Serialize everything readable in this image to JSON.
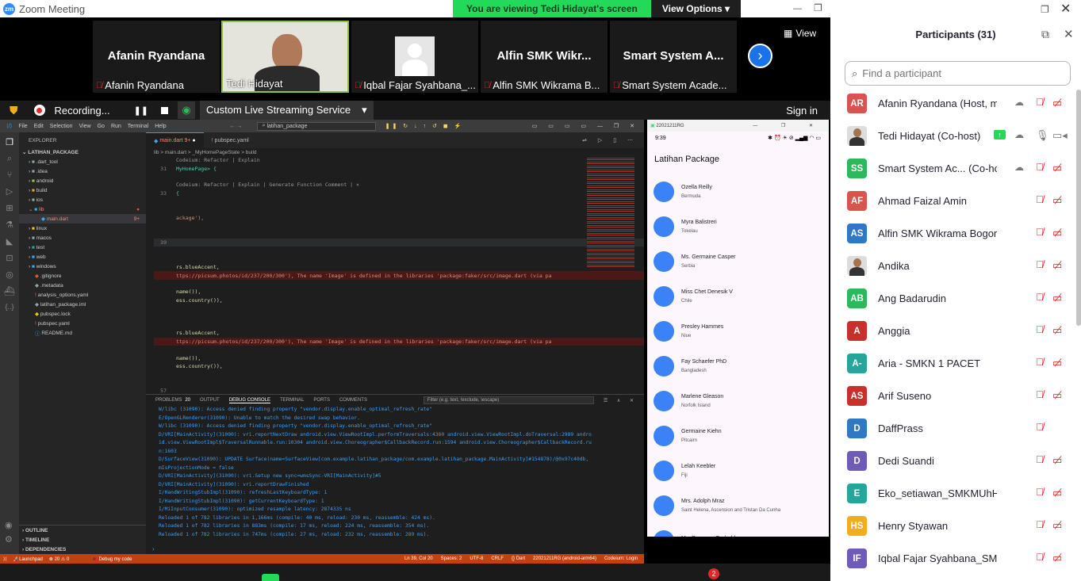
{
  "window": {
    "title": "Zoom Meeting",
    "logo": "zm"
  },
  "banner": {
    "viewing": "You are viewing Tedi Hidayat's screen",
    "options": "View Options"
  },
  "view_label": "View",
  "thumbnails": [
    {
      "big": "Afanin Ryandana",
      "label": "Afanin Ryandana",
      "video": false
    },
    {
      "big": "",
      "label": "Tedi Hidayat",
      "video": true
    },
    {
      "big": "",
      "label": "Iqbal Fajar Syahbana_...",
      "avatar": true
    },
    {
      "big": "Alfin SMK Wikr...",
      "label": "Alfin SMK Wikrama B..."
    },
    {
      "big": "Smart System A...",
      "label": "Smart System Acade..."
    }
  ],
  "recording": {
    "label": "Recording...",
    "streaming": "Custom Live Streaming Service",
    "signin": "Sign in"
  },
  "vscode": {
    "menu": [
      "File",
      "Edit",
      "Selection",
      "View",
      "Go",
      "Run",
      "Terminal",
      "Help"
    ],
    "search": "latihan_package",
    "explorer_title": "EXPLORER",
    "project": "LATIHAN_PACKAGE",
    "files": [
      ".dart_tool",
      ".idea",
      "android",
      "build",
      "ios",
      "lib",
      "main.dart",
      "linux",
      "macos",
      "test",
      "web",
      "windows",
      ".gitignore",
      ".metadata",
      "analysis_options.yaml",
      "latihan_package.iml",
      "pubspec.lock",
      "pubspec.yaml",
      "README.md"
    ],
    "main_badge": "9+",
    "outline": [
      "OUTLINE",
      "TIMELINE",
      "DEPENDENCIES"
    ],
    "tabs": [
      "main.dart 9+",
      "pubspec.yaml"
    ],
    "breadcrumb": "lib > main.dart > _MyHomePageState > build",
    "code": [
      {
        "n": "",
        "t": "Codeium: Refactor | Explain"
      },
      {
        "n": "31",
        "t": "MyHomePage> {"
      },
      {
        "n": "",
        "t": ""
      },
      {
        "n": "",
        "t": "Codeium: Refactor | Explain | Generate Function Comment | ×"
      },
      {
        "n": "33",
        "t": "{"
      },
      {
        "n": "",
        "t": ""
      },
      {
        "n": "",
        "t": ""
      },
      {
        "n": "",
        "t": "ackage'),"
      },
      {
        "n": "",
        "t": ""
      },
      {
        "n": "",
        "t": ""
      },
      {
        "n": "39",
        "t": ""
      },
      {
        "n": "",
        "t": ""
      },
      {
        "n": "",
        "t": ""
      },
      {
        "n": "",
        "t": "rs.blueAccent,"
      },
      {
        "n": "",
        "t": "ttps://picsum.photos/id/237/200/300'),     The name 'Image' is defined in the libraries 'package:faker/src/image.dart (via pa"
      },
      {
        "n": "",
        "t": ""
      },
      {
        "n": "",
        "t": "name()),"
      },
      {
        "n": "",
        "t": "ess.country()),"
      },
      {
        "n": "",
        "t": ""
      },
      {
        "n": "",
        "t": ""
      },
      {
        "n": "",
        "t": ""
      },
      {
        "n": "",
        "t": "rs.blueAccent,"
      },
      {
        "n": "",
        "t": "ttps://picsum.photos/id/237/200/300'),     The name 'Image' is defined in the libraries 'package:faker/src/image.dart (via pa"
      },
      {
        "n": "",
        "t": ""
      },
      {
        "n": "",
        "t": "name()),"
      },
      {
        "n": "",
        "t": "ess.country()),"
      },
      {
        "n": "",
        "t": ""
      },
      {
        "n": "",
        "t": ""
      },
      {
        "n": "57",
        "t": ""
      }
    ],
    "panel_tabs": [
      "PROBLEMS",
      "20",
      "OUTPUT",
      "DEBUG CONSOLE",
      "TERMINAL",
      "PORTS",
      "COMMENTS"
    ],
    "filter": "Filter (e.g. text, !exclude, \\escape)",
    "console": [
      "W/libc    (31090): Access denied finding property \"vendor.display.enable_optimal_refresh_rate\"",
      "E/OpenGLRenderer(31090): Unable to match the desired swap behavior.",
      "W/libc    (31090): Access denied finding property \"vendor.display.enable_optimal_refresh_rate\"",
      "D/VRI[MainActivity](31090): vri.reportNextDraw android.view.ViewRootImpl.performTraversals:4360 android.view.ViewRootImpl.doTraversal:2989 andro",
      "id.view.ViewRootImpl$TraversalRunnable.run:10304 android.view.Choreographer$CallbackRecord.run:1594 android.view.Choreographer$CallbackRecord.ru",
      "n:1603",
      "D/SurfaceView(31090): UPDATE Surface(name=SurfaceView[com.example.latihan_package/com.example.latihan_package.MainActivity]#154878)/@0x97c40db,",
      "mIsProjectionMode = false",
      "D/VRI[MainActivity](31090): vri.Setup new sync=wmsSync-VRI[MainActivity]#5",
      "D/VRI[MainActivity](31090): vri.reportDrawFinished",
      "I/HandWritingStubImpl(31090): refreshLastKeyboardType: 1",
      "I/HandWritingStubImpl(31090): getCurrentKeyboardType: 1",
      "I/MiInputConsumer(31090): optimized resample latency: 2874335 ns",
      "Reloaded 1 of 782 libraries in 1,166ms (compile: 40 ms, reload: 230 ms, reassemble: 424 ms).",
      "Reloaded 1 of 782 libraries in 883ms (compile: 17 ms, reload: 224 ms, reassemble: 354 ms).",
      "Reloaded 1 of 782 libraries in 747ms (compile: 27 ms, reload: 232 ms, reassemble: 289 ms)."
    ],
    "status": {
      "launchpad": "Launchpad",
      "errors": "⊗ 20 ⚠ 0",
      "debug": "Debug my code",
      "pos": "Ln 39, Col 20",
      "spaces": "Spaces: 2",
      "enc": "UTF-8",
      "eol": "CRLF",
      "lang": "Dart",
      "device": "22021211RG (android-arm64)",
      "codeium": "Codeium: Login"
    }
  },
  "emulator": {
    "title": "22021211RG",
    "time": "9:39",
    "app_title": "Latihan Package",
    "items": [
      {
        "name": "Ozella Reilly",
        "place": "Bermuda"
      },
      {
        "name": "Myra Balistreri",
        "place": "Tokelau"
      },
      {
        "name": "Ms. Germaine Casper",
        "place": "Serbia"
      },
      {
        "name": "Miss Chet Denesik V",
        "place": "Chile"
      },
      {
        "name": "Presley Hammes",
        "place": "Niue"
      },
      {
        "name": "Fay Schaefer PhD",
        "place": "Bangladesh"
      },
      {
        "name": "Marlene Gleason",
        "place": "Norfolk Island"
      },
      {
        "name": "Germaine Kiehn",
        "place": "Pitcairn"
      },
      {
        "name": "Lelah Keebler",
        "place": "Fiji"
      },
      {
        "name": "Mrs. Adolph Mraz",
        "place": "Saint Helena, Ascension and Tristan Da Cunha"
      },
      {
        "name": "Ms. Donavon Gerhold",
        "place": ""
      }
    ]
  },
  "taskbar": {
    "badge": "2"
  },
  "participants": {
    "title": "Participants (31)",
    "search_placeholder": "Find a participant",
    "list": [
      {
        "initials": "AR",
        "color": "#d9534f",
        "name": "Afanin Ryandana (Host, me)",
        "cloud": true,
        "video": true
      },
      {
        "initials": "",
        "color": "#555555",
        "name": "Tedi Hidayat (Co-host)",
        "photo": true,
        "share": true,
        "cloud": true,
        "mic_on": true,
        "video_on": true
      },
      {
        "initials": "SS",
        "color": "#2eb85c",
        "name": "Smart System Ac... (Co-host)",
        "cloud": true,
        "video": true
      },
      {
        "initials": "AF",
        "color": "#d9534f",
        "name": "Ahmad Faizal Amin",
        "video": true
      },
      {
        "initials": "AS",
        "color": "#2f78c4",
        "name": "Alfin SMK Wikrama Bogor",
        "video": true
      },
      {
        "initials": "",
        "color": "#666666",
        "name": "Andika",
        "photo": true,
        "video": true
      },
      {
        "initials": "AB",
        "color": "#2eb85c",
        "name": "Ang Badarudin",
        "video": true
      },
      {
        "initials": "A",
        "color": "#c9302c",
        "name": "Anggia",
        "video": true
      },
      {
        "initials": "A-",
        "color": "#26a69a",
        "name": "Aria - SMKN 1 PACET",
        "video": true
      },
      {
        "initials": "AS",
        "color": "#c9302c",
        "name": "Arif Suseno",
        "video": true
      },
      {
        "initials": "D",
        "color": "#2f78c4",
        "name": "DaffPrass",
        "video": false
      },
      {
        "initials": "D",
        "color": "#6f5bb5",
        "name": "Dedi Suandi",
        "video": true
      },
      {
        "initials": "E",
        "color": "#26a69a",
        "name": "Eko_setiawan_SMKMUhHGL",
        "video": true
      },
      {
        "initials": "HS",
        "color": "#f0ad1e",
        "name": "Henry Styawan",
        "video": true
      },
      {
        "initials": "IF",
        "color": "#6f5bb5",
        "name": "Iqbal Fajar Syahbana_SMK Wik...",
        "video": true
      }
    ]
  }
}
